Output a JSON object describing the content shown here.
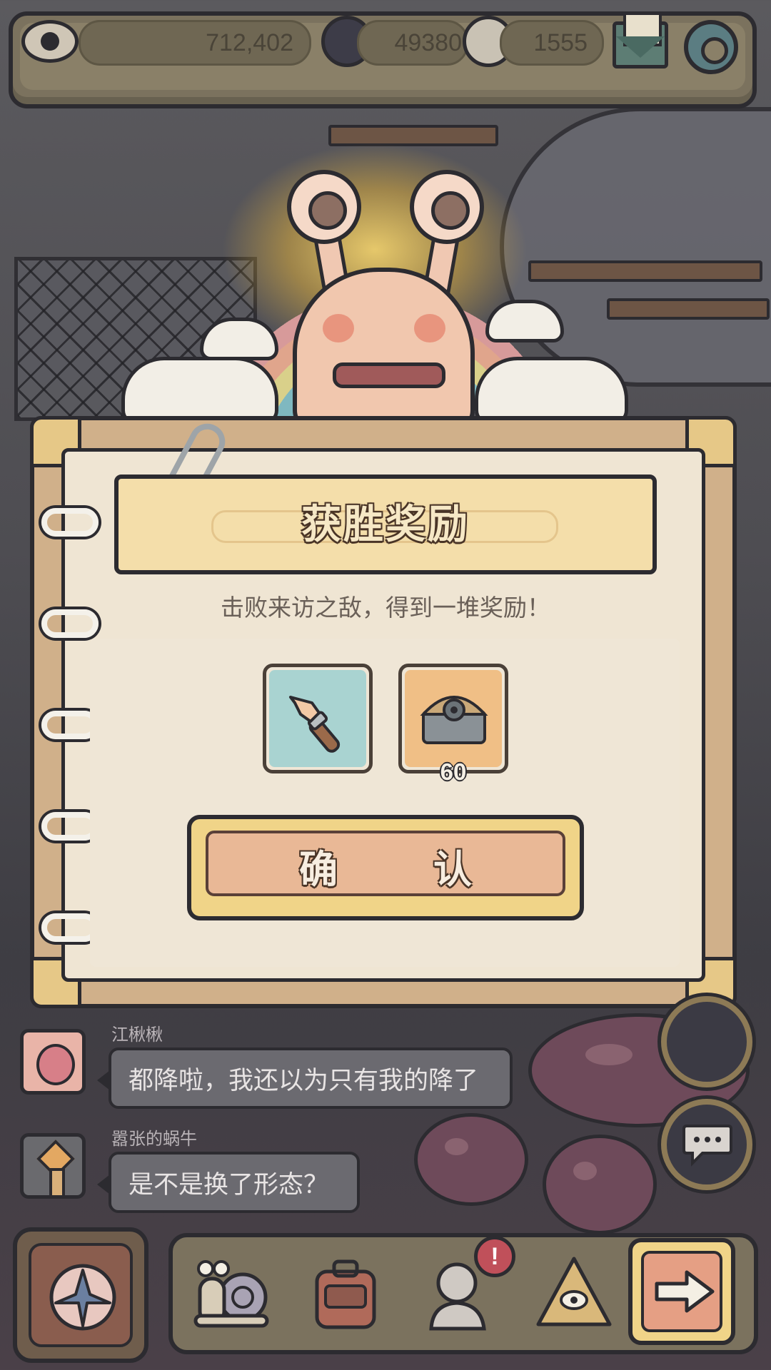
{
  "topbar": {
    "eyes_value": "712,402",
    "currency1_value": "49380",
    "currency2_value": "1555"
  },
  "dialog": {
    "title": "获胜奖励",
    "subtitle": "击败来访之敌，得到一堆奖励！",
    "rewards": [
      {
        "name": "pointing-hand-item",
        "quantity": ""
      },
      {
        "name": "treasure-chest-item",
        "quantity": "60"
      }
    ],
    "confirm_label": "确　认"
  },
  "chat": {
    "messages": [
      {
        "user": "江楸楸",
        "text": "都降啦，我还以为只有我的降了"
      },
      {
        "user": "嚣张的蜗牛",
        "text": "是不是换了形态？"
      }
    ]
  },
  "nav": {
    "alert_badge": "!"
  },
  "colors": {
    "accent_gold": "#f0d488",
    "confirm_button": "#e9b896",
    "paper": "#efe5d3",
    "outline": "#2c2b30"
  }
}
